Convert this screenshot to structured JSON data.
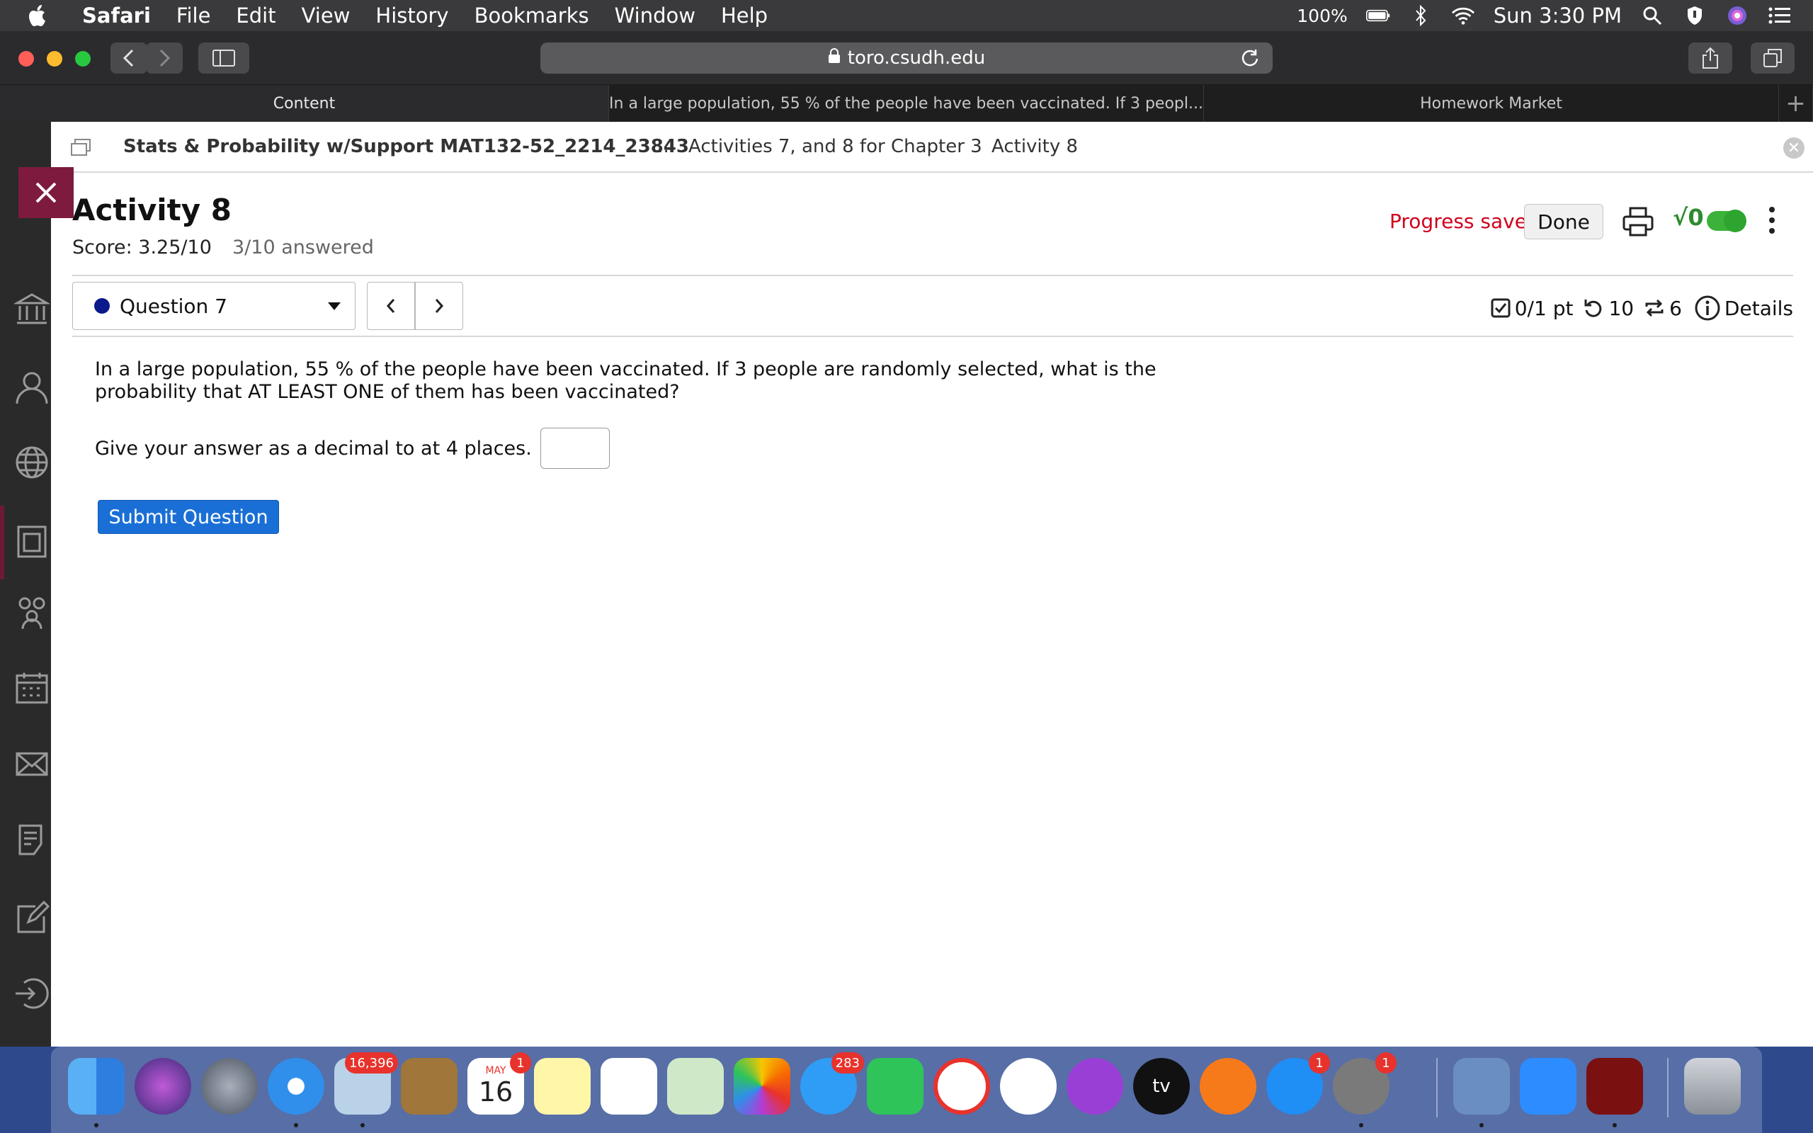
{
  "menubar": {
    "app": "Safari",
    "items": [
      "File",
      "Edit",
      "View",
      "History",
      "Bookmarks",
      "Window",
      "Help"
    ],
    "battery": "100%",
    "clock": "Sun 3:30 PM"
  },
  "browser": {
    "url": "toro.csudh.edu",
    "tabs": [
      {
        "label": "Content",
        "active": true
      },
      {
        "label": "In a large population, 55 % of the people have been vaccinated. If 3 peopl...",
        "active": false
      },
      {
        "label": "Homework Market",
        "active": false
      }
    ],
    "new_tab": "+"
  },
  "breadcrumb": {
    "course": "Stats & Probability w/Support MAT132-52_2214_23843",
    "ellipsis": "...",
    "module": "Activities 7, and 8 for Chapter 3",
    "current": "Activity 8"
  },
  "activity": {
    "title": "Activity 8",
    "score": "Score: 3.25/10",
    "answered": "3/10 answered",
    "progress_status": "Progress saved",
    "done_label": "Done",
    "math_toggle_label": "√0"
  },
  "question": {
    "selector_label": "Question 7",
    "points": "0/1 pt",
    "retries": "10",
    "attempts": "6",
    "details_label": "Details",
    "text": "In a large population, 55 % of the people have been vaccinated. If 3 people are randomly selected, what is the probability that AT LEAST ONE of them has been vaccinated?",
    "answer_prompt": "Give your answer as a decimal to at 4 places.",
    "answer_value": "",
    "submit_label": "Submit Question"
  },
  "dock": {
    "mail_badge": "16,396",
    "calendar_month": "MAY",
    "calendar_day": "16",
    "calendar_badge": "1",
    "messages_badge": "283",
    "appstore_badge": "1",
    "prefs_badge": "1",
    "tv_label": "tv"
  },
  "colors": {
    "accent_maroon": "#7d1a3e",
    "progress_red": "#d0021b",
    "submit_blue": "#1a6fd6",
    "toggle_green": "#3bb33b"
  }
}
